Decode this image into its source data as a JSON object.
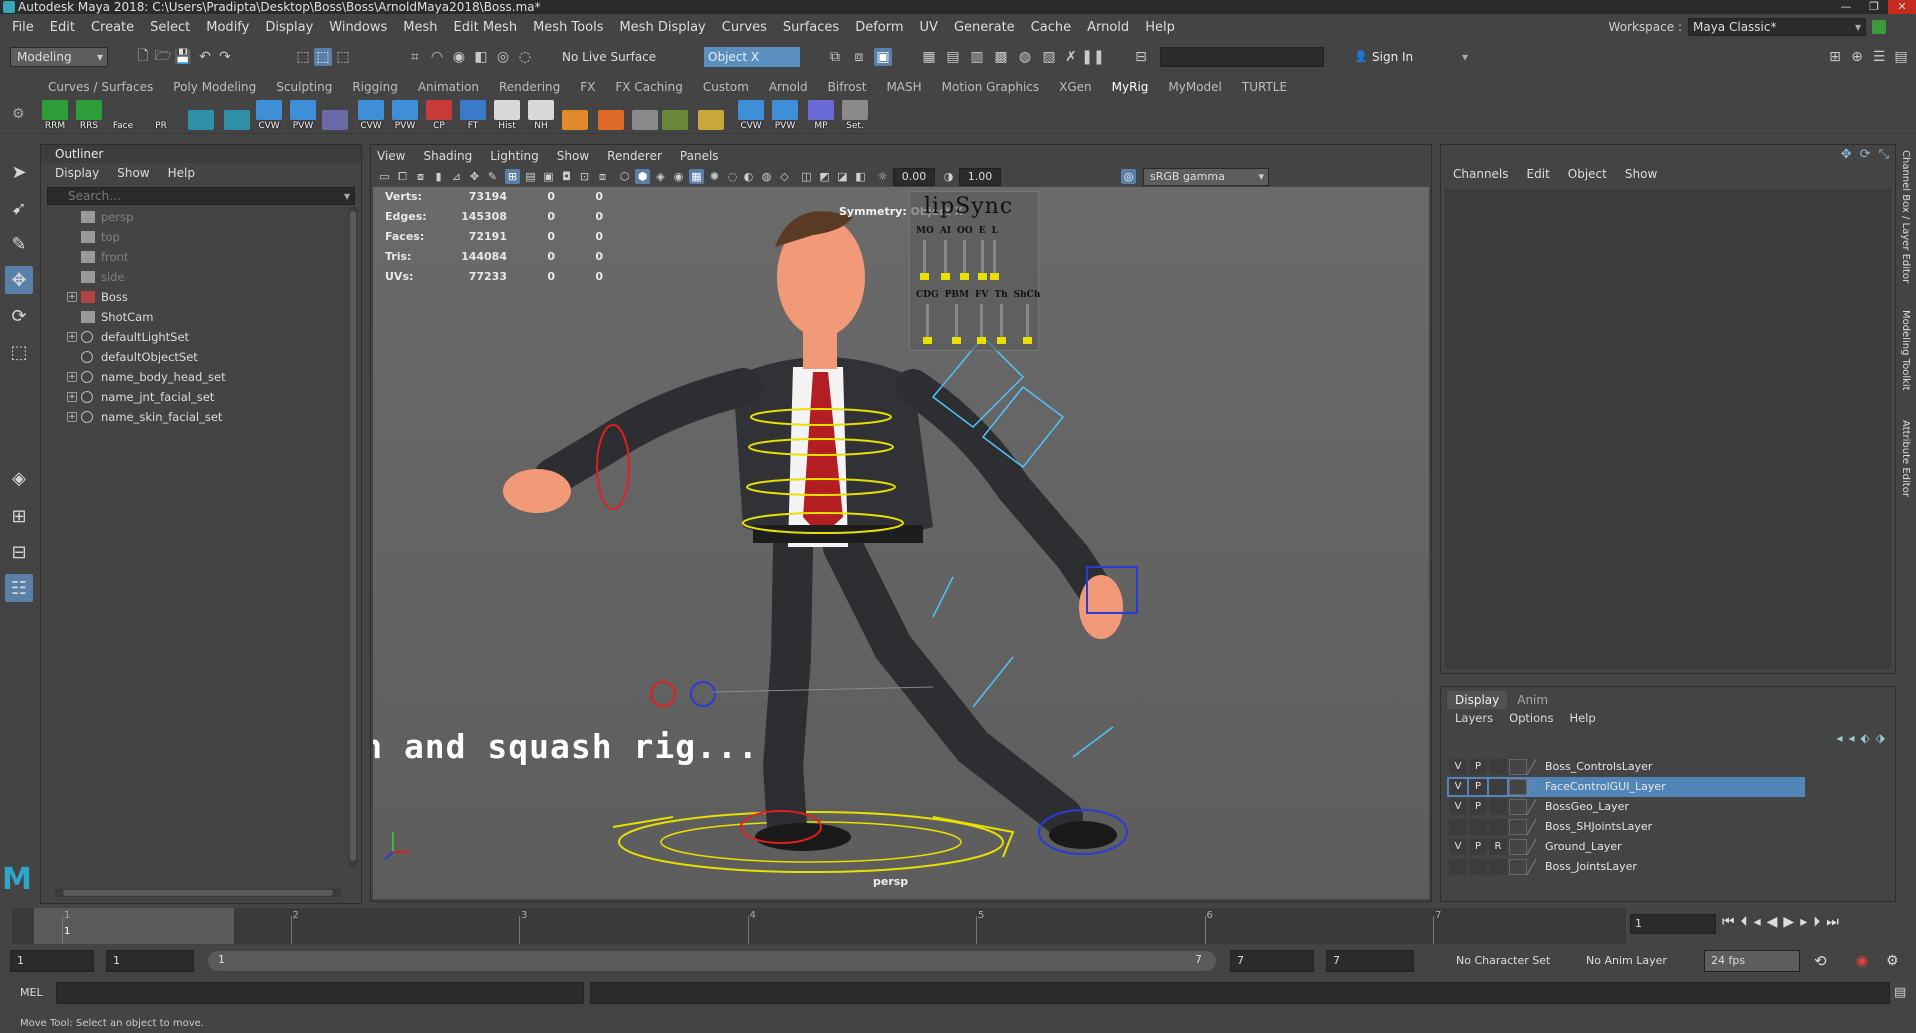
{
  "window": {
    "title": "Autodesk Maya 2018: C:\\Users\\Pradipta\\Desktop\\Boss\\Boss\\ArnoldMaya2018\\Boss.ma*"
  },
  "menubar": {
    "items": [
      "File",
      "Edit",
      "Create",
      "Select",
      "Modify",
      "Display",
      "Windows",
      "Mesh",
      "Edit Mesh",
      "Mesh Tools",
      "Mesh Display",
      "Curves",
      "Surfaces",
      "Deform",
      "UV",
      "Generate",
      "Cache",
      "Arnold",
      "Help"
    ],
    "workspace_label": "Workspace :",
    "workspace_value": "Maya Classic*"
  },
  "statusline": {
    "mode": "Modeling",
    "live_surface": "No Live Surface",
    "symmetry": "Object X",
    "sign_in": "Sign In"
  },
  "shelf": {
    "tabs": [
      "Curves / Surfaces",
      "Poly Modeling",
      "Sculpting",
      "Rigging",
      "Animation",
      "Rendering",
      "FX",
      "FX Caching",
      "Custom",
      "Arnold",
      "Bifrost",
      "MASH",
      "Motion Graphics",
      "XGen",
      "MyRig",
      "MyModel",
      "TURTLE"
    ],
    "active_tab": "MyRig",
    "buttons": [
      "RRM",
      "RRS",
      "Face",
      "PR",
      "",
      "",
      "CVW",
      "PVW",
      "",
      "CVW",
      "PVW",
      "CP",
      "FT",
      "Hist",
      "NH",
      "",
      "",
      "",
      "",
      "",
      "CVW",
      "PVW",
      "MP",
      "Set."
    ]
  },
  "outliner": {
    "title": "Outliner",
    "menu": [
      "Display",
      "Show",
      "Help"
    ],
    "search_placeholder": "Search...",
    "items": [
      {
        "label": "persp",
        "dim": true,
        "expand": false
      },
      {
        "label": "top",
        "dim": true,
        "expand": false
      },
      {
        "label": "front",
        "dim": true,
        "expand": false
      },
      {
        "label": "side",
        "dim": true,
        "expand": false
      },
      {
        "label": "Boss",
        "dim": false,
        "expand": true
      },
      {
        "label": "ShotCam",
        "dim": false,
        "expand": false
      },
      {
        "label": "defaultLightSet",
        "dim": false,
        "expand": true
      },
      {
        "label": "defaultObjectSet",
        "dim": false,
        "expand": false
      },
      {
        "label": "name_body_head_set",
        "dim": false,
        "expand": true
      },
      {
        "label": "name_jnt_facial_set",
        "dim": false,
        "expand": true
      },
      {
        "label": "name_skin_facial_set",
        "dim": false,
        "expand": true
      }
    ]
  },
  "viewport": {
    "menu": [
      "View",
      "Shading",
      "Lighting",
      "Show",
      "Renderer",
      "Panels"
    ],
    "exposure": "0.00",
    "gamma_value": "1.00",
    "color_space": "sRGB gamma",
    "hud": [
      {
        "label": "Verts:",
        "a": "73194",
        "b": "0",
        "c": "0"
      },
      {
        "label": "Edges:",
        "a": "145308",
        "b": "0",
        "c": "0"
      },
      {
        "label": "Faces:",
        "a": "72191",
        "b": "0",
        "c": "0"
      },
      {
        "label": "Tris:",
        "a": "144084",
        "b": "0",
        "c": "0"
      },
      {
        "label": "UVs:",
        "a": "77233",
        "b": "0",
        "c": "0"
      }
    ],
    "symmetry_hud": "Symmetry: Object X",
    "overlay_text": "stretch and squash rig...",
    "camera": "persp",
    "lipsync": {
      "title": "lipSync",
      "row1": [
        "MO",
        "AI",
        "OO",
        "E",
        "L"
      ],
      "row2": [
        "CDG",
        "PBM",
        "FV",
        "Th",
        "ShCh"
      ]
    }
  },
  "channelbox": {
    "menu": [
      "Channels",
      "Edit",
      "Object",
      "Show"
    ]
  },
  "layer_editor": {
    "tabs": [
      "Display",
      "Anim"
    ],
    "menu": [
      "Layers",
      "Options",
      "Help"
    ],
    "layers": [
      {
        "v": "V",
        "p": "P",
        "r": "",
        "name": "Boss_ControlsLayer",
        "selected": false
      },
      {
        "v": "V",
        "p": "P",
        "r": "",
        "name": "FaceControlGUI_Layer",
        "selected": true
      },
      {
        "v": "V",
        "p": "P",
        "r": "",
        "name": "BossGeo_Layer",
        "selected": false
      },
      {
        "v": "",
        "p": "",
        "r": "",
        "name": "Boss_SHJointsLayer",
        "selected": false
      },
      {
        "v": "V",
        "p": "P",
        "r": "R",
        "name": "Ground_Layer",
        "selected": false
      },
      {
        "v": "",
        "p": "",
        "r": "",
        "name": "Boss_JointsLayer",
        "selected": false
      }
    ]
  },
  "side_tabs": [
    "Channel Box / Layer Editor",
    "Modeling Toolkit",
    "Attribute Editor"
  ],
  "timeline": {
    "ticks": [
      "1",
      "2",
      "3",
      "4",
      "5",
      "6",
      "7"
    ],
    "current_frame_label": "1",
    "current_frame": "1"
  },
  "range": {
    "start": "1",
    "playback_start": "1",
    "slider_start": "1",
    "slider_end": "7",
    "playback_end": "7",
    "end": "7",
    "character_set": "No Character Set",
    "anim_layer": "No Anim Layer",
    "fps": "24 fps"
  },
  "command_line": {
    "label": "MEL"
  },
  "help_line": "Move Tool: Select an object to move.",
  "colors": {
    "ui_bg": "#444444",
    "selection": "#5285b8",
    "active_tool": "#5a7fa8",
    "viewport_bg": "#646464"
  }
}
